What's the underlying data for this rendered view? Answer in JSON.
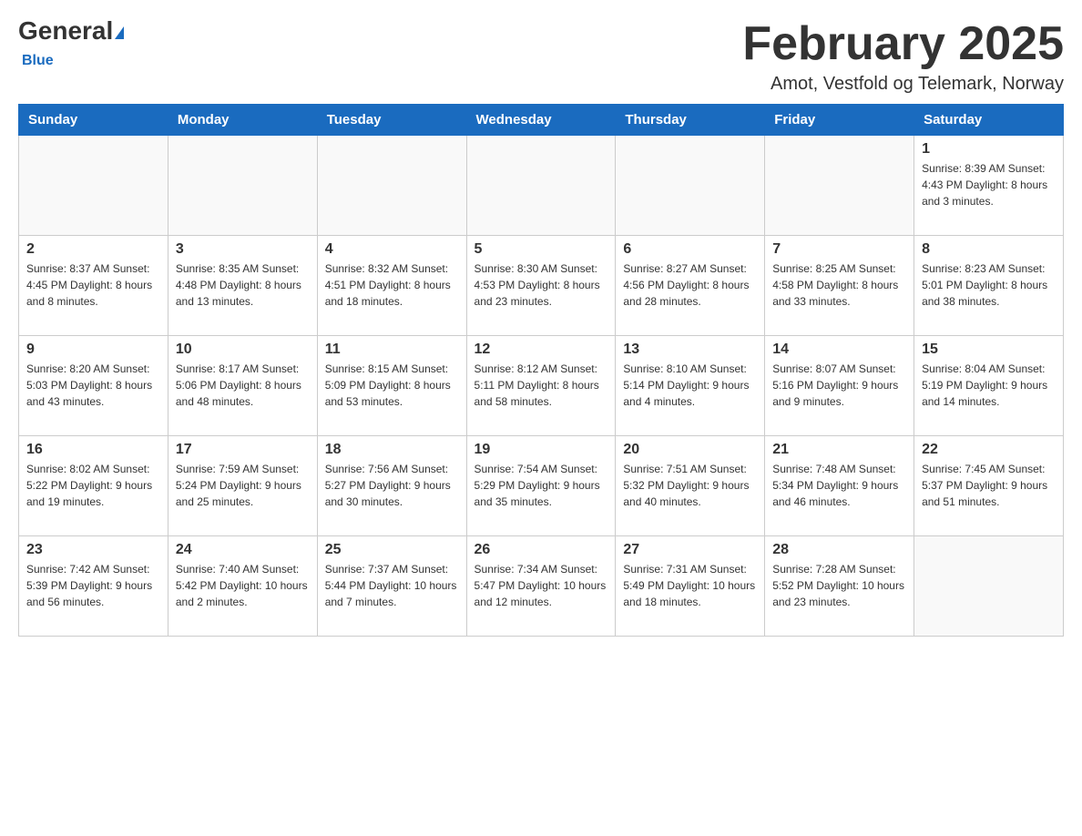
{
  "logo": {
    "general": "General",
    "blue": "Blue",
    "underline": "Blue"
  },
  "header": {
    "title": "February 2025",
    "subtitle": "Amot, Vestfold og Telemark, Norway"
  },
  "days_of_week": [
    "Sunday",
    "Monday",
    "Tuesday",
    "Wednesday",
    "Thursday",
    "Friday",
    "Saturday"
  ],
  "weeks": [
    [
      {
        "day": "",
        "info": ""
      },
      {
        "day": "",
        "info": ""
      },
      {
        "day": "",
        "info": ""
      },
      {
        "day": "",
        "info": ""
      },
      {
        "day": "",
        "info": ""
      },
      {
        "day": "",
        "info": ""
      },
      {
        "day": "1",
        "info": "Sunrise: 8:39 AM\nSunset: 4:43 PM\nDaylight: 8 hours and 3 minutes."
      }
    ],
    [
      {
        "day": "2",
        "info": "Sunrise: 8:37 AM\nSunset: 4:45 PM\nDaylight: 8 hours and 8 minutes."
      },
      {
        "day": "3",
        "info": "Sunrise: 8:35 AM\nSunset: 4:48 PM\nDaylight: 8 hours and 13 minutes."
      },
      {
        "day": "4",
        "info": "Sunrise: 8:32 AM\nSunset: 4:51 PM\nDaylight: 8 hours and 18 minutes."
      },
      {
        "day": "5",
        "info": "Sunrise: 8:30 AM\nSunset: 4:53 PM\nDaylight: 8 hours and 23 minutes."
      },
      {
        "day": "6",
        "info": "Sunrise: 8:27 AM\nSunset: 4:56 PM\nDaylight: 8 hours and 28 minutes."
      },
      {
        "day": "7",
        "info": "Sunrise: 8:25 AM\nSunset: 4:58 PM\nDaylight: 8 hours and 33 minutes."
      },
      {
        "day": "8",
        "info": "Sunrise: 8:23 AM\nSunset: 5:01 PM\nDaylight: 8 hours and 38 minutes."
      }
    ],
    [
      {
        "day": "9",
        "info": "Sunrise: 8:20 AM\nSunset: 5:03 PM\nDaylight: 8 hours and 43 minutes."
      },
      {
        "day": "10",
        "info": "Sunrise: 8:17 AM\nSunset: 5:06 PM\nDaylight: 8 hours and 48 minutes."
      },
      {
        "day": "11",
        "info": "Sunrise: 8:15 AM\nSunset: 5:09 PM\nDaylight: 8 hours and 53 minutes."
      },
      {
        "day": "12",
        "info": "Sunrise: 8:12 AM\nSunset: 5:11 PM\nDaylight: 8 hours and 58 minutes."
      },
      {
        "day": "13",
        "info": "Sunrise: 8:10 AM\nSunset: 5:14 PM\nDaylight: 9 hours and 4 minutes."
      },
      {
        "day": "14",
        "info": "Sunrise: 8:07 AM\nSunset: 5:16 PM\nDaylight: 9 hours and 9 minutes."
      },
      {
        "day": "15",
        "info": "Sunrise: 8:04 AM\nSunset: 5:19 PM\nDaylight: 9 hours and 14 minutes."
      }
    ],
    [
      {
        "day": "16",
        "info": "Sunrise: 8:02 AM\nSunset: 5:22 PM\nDaylight: 9 hours and 19 minutes."
      },
      {
        "day": "17",
        "info": "Sunrise: 7:59 AM\nSunset: 5:24 PM\nDaylight: 9 hours and 25 minutes."
      },
      {
        "day": "18",
        "info": "Sunrise: 7:56 AM\nSunset: 5:27 PM\nDaylight: 9 hours and 30 minutes."
      },
      {
        "day": "19",
        "info": "Sunrise: 7:54 AM\nSunset: 5:29 PM\nDaylight: 9 hours and 35 minutes."
      },
      {
        "day": "20",
        "info": "Sunrise: 7:51 AM\nSunset: 5:32 PM\nDaylight: 9 hours and 40 minutes."
      },
      {
        "day": "21",
        "info": "Sunrise: 7:48 AM\nSunset: 5:34 PM\nDaylight: 9 hours and 46 minutes."
      },
      {
        "day": "22",
        "info": "Sunrise: 7:45 AM\nSunset: 5:37 PM\nDaylight: 9 hours and 51 minutes."
      }
    ],
    [
      {
        "day": "23",
        "info": "Sunrise: 7:42 AM\nSunset: 5:39 PM\nDaylight: 9 hours and 56 minutes."
      },
      {
        "day": "24",
        "info": "Sunrise: 7:40 AM\nSunset: 5:42 PM\nDaylight: 10 hours and 2 minutes."
      },
      {
        "day": "25",
        "info": "Sunrise: 7:37 AM\nSunset: 5:44 PM\nDaylight: 10 hours and 7 minutes."
      },
      {
        "day": "26",
        "info": "Sunrise: 7:34 AM\nSunset: 5:47 PM\nDaylight: 10 hours and 12 minutes."
      },
      {
        "day": "27",
        "info": "Sunrise: 7:31 AM\nSunset: 5:49 PM\nDaylight: 10 hours and 18 minutes."
      },
      {
        "day": "28",
        "info": "Sunrise: 7:28 AM\nSunset: 5:52 PM\nDaylight: 10 hours and 23 minutes."
      },
      {
        "day": "",
        "info": ""
      }
    ]
  ]
}
